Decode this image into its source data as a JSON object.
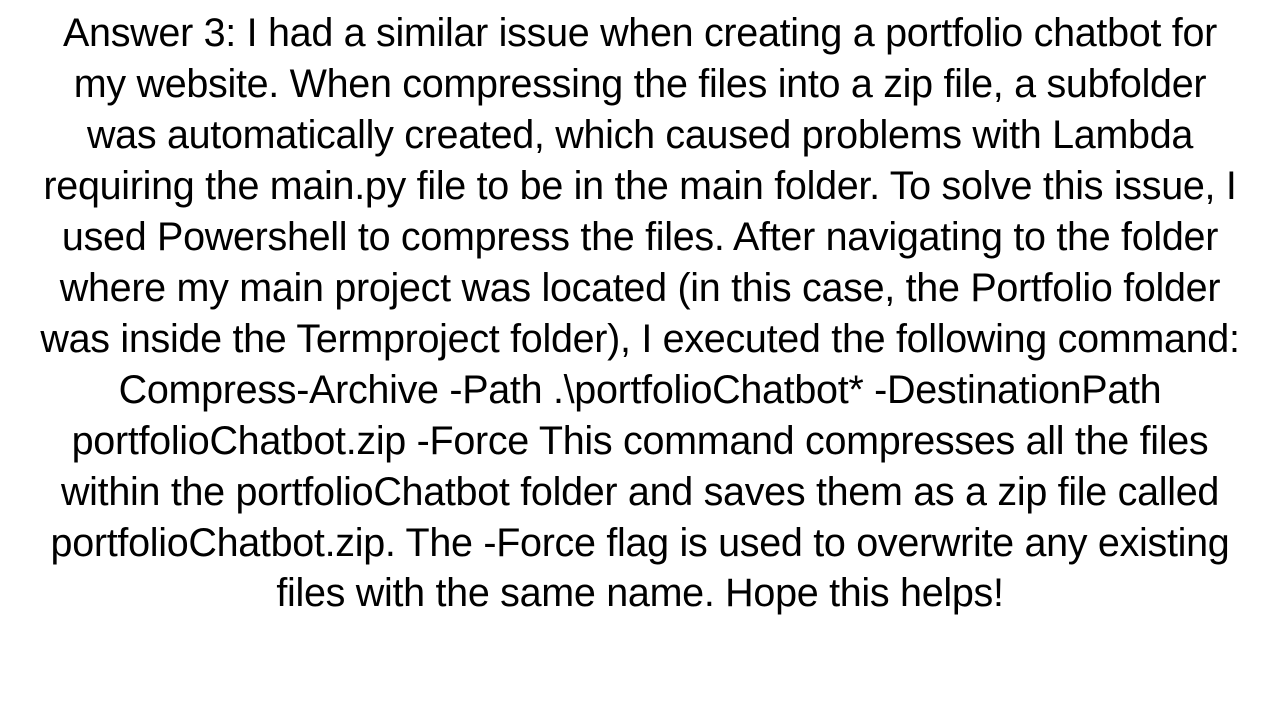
{
  "answer": {
    "label": "Answer 3:",
    "body": "I had a similar issue when creating a portfolio chatbot for my website. When compressing the files into a zip file, a subfolder was automatically created, which caused problems with Lambda requiring the main.py file to be in the main folder. To solve this issue, I used Powershell to compress the files. After navigating to the folder where my main project was located (in this case, the Portfolio folder was inside the Termproject folder), I executed the following command: Compress-Archive -Path .\\portfolioChatbot* -DestinationPath portfolioChatbot.zip -Force This command compresses all the files within the portfolioChatbot folder and saves them as a zip file called portfolioChatbot.zip. The -Force flag is used to overwrite any existing files with the same name. Hope this helps!"
  }
}
